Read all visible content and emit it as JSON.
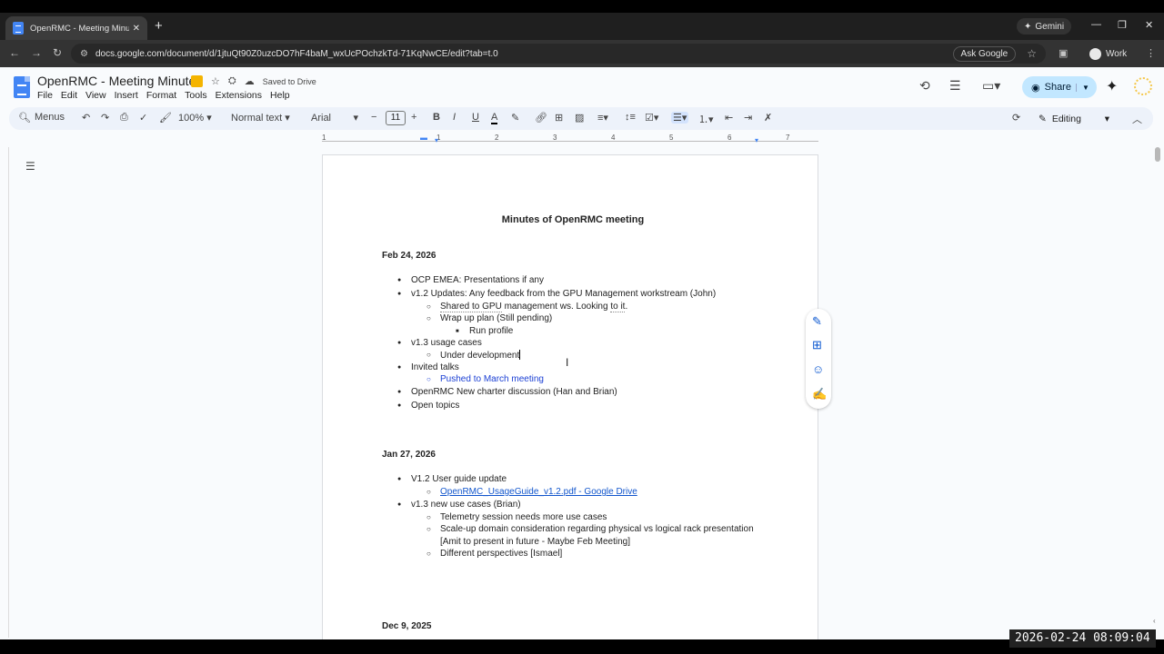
{
  "browser": {
    "tab_title": "OpenRMC - Meeting Minute",
    "gemini_label": "Gemini",
    "url": "docs.google.com/document/d/1jtuQt90Z0uzcDO7hF4baM_wxUcPOchzkTd-71KqNwCE/edit?tab=t.0",
    "ask_google": "Ask Google",
    "profile_label": "Work"
  },
  "docs": {
    "title": "OpenRMC - Meeting Minutes",
    "saved_status": "Saved to Drive",
    "menu": [
      "File",
      "Edit",
      "View",
      "Insert",
      "Format",
      "Tools",
      "Extensions",
      "Help"
    ],
    "share_label": "Share"
  },
  "toolbar": {
    "menus_label": "Menus",
    "zoom": "100%",
    "style": "Normal text",
    "font": "Arial",
    "font_size": "11",
    "mode": "Editing"
  },
  "ruler": [
    "1",
    "1",
    "2",
    "3",
    "4",
    "5",
    "6",
    "7"
  ],
  "document": {
    "heading": "Minutes of OpenRMC meeting",
    "section1": {
      "date": "Feb 24, 2026",
      "items": [
        "OCP EMEA: Presentations if any",
        "v1.2 Updates: Any feedback from the GPU Management workstream (John)",
        "Shared to GPU",
        " management ws. Looking ",
        "to it",
        ".",
        "Wrap up plan (Still pending)",
        "Run profile",
        "v1.3 usage cases",
        "Under development",
        "Invited talks",
        "Pushed to March meeting",
        "OpenRMC New charter discussion (Han and Brian)",
        "Open topics"
      ]
    },
    "section2": {
      "date": "Jan 27, 2026",
      "items": [
        "V1.2 User guide update",
        "OpenRMC_UsageGuide_v1.2.pdf - Google Drive",
        "v1.3 new use cases (Brian)",
        "Telemetry session needs more use cases",
        "Scale-up domain consideration regarding physical vs logical rack presentation",
        "[Amit to present in future - Maybe Feb Meeting]",
        "Different perspectives [Ismael]"
      ]
    },
    "section3": {
      "date": "Dec 9, 2025"
    }
  },
  "overlay": {
    "timestamp": "2026-02-24 08:09:04"
  }
}
